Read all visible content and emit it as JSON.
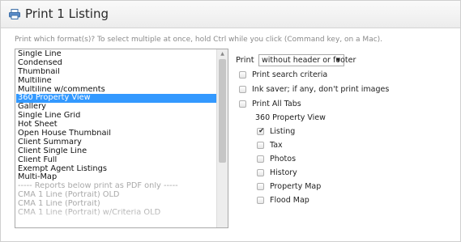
{
  "dialog": {
    "title": "Print 1 Listing",
    "icon": "printer-icon",
    "instructions": "Print which format(s)? To select multiple at once, hold Ctrl while you click (Command key, on a Mac)."
  },
  "format_list": {
    "items": [
      {
        "label": "Single Line",
        "selected": false,
        "muted": false
      },
      {
        "label": "Condensed",
        "selected": false,
        "muted": false
      },
      {
        "label": "Thumbnail",
        "selected": false,
        "muted": false
      },
      {
        "label": "Multiline",
        "selected": false,
        "muted": false
      },
      {
        "label": "Multiline w/comments",
        "selected": false,
        "muted": false
      },
      {
        "label": "360 Property View",
        "selected": true,
        "muted": false
      },
      {
        "label": "Gallery",
        "selected": false,
        "muted": false
      },
      {
        "label": "Single Line Grid",
        "selected": false,
        "muted": false
      },
      {
        "label": "Hot Sheet",
        "selected": false,
        "muted": false
      },
      {
        "label": "Open House Thumbnail",
        "selected": false,
        "muted": false
      },
      {
        "label": "Client Summary",
        "selected": false,
        "muted": false
      },
      {
        "label": "Client Single Line",
        "selected": false,
        "muted": false
      },
      {
        "label": "Client Full",
        "selected": false,
        "muted": false
      },
      {
        "label": "Exempt Agent Listings",
        "selected": false,
        "muted": false
      },
      {
        "label": "Multi-Map",
        "selected": false,
        "muted": false
      },
      {
        "label": "----- Reports below print as PDF only -----",
        "selected": false,
        "muted": true
      },
      {
        "label": "CMA 1 Line (Portrait) OLD",
        "selected": false,
        "muted": true
      },
      {
        "label": "CMA 1 Line (Portrait)",
        "selected": false,
        "muted": true
      },
      {
        "label": "CMA 1 Line (Portrait) w/Criteria OLD",
        "selected": false,
        "muted": true
      }
    ]
  },
  "options": {
    "print_label": "Print",
    "print_select_value": "without header or footer",
    "checkboxes": [
      {
        "label": "Print search criteria",
        "checked": false
      },
      {
        "label": "Ink saver; if any, don't print images",
        "checked": false
      },
      {
        "label": "Print All Tabs",
        "checked": false
      }
    ],
    "section_label": "360 Property View",
    "tabs": [
      {
        "label": "Listing",
        "checked": true
      },
      {
        "label": "Tax",
        "checked": false
      },
      {
        "label": "Photos",
        "checked": false
      },
      {
        "label": "History",
        "checked": false
      },
      {
        "label": "Property Map",
        "checked": false
      },
      {
        "label": "Flood Map",
        "checked": false
      }
    ]
  }
}
